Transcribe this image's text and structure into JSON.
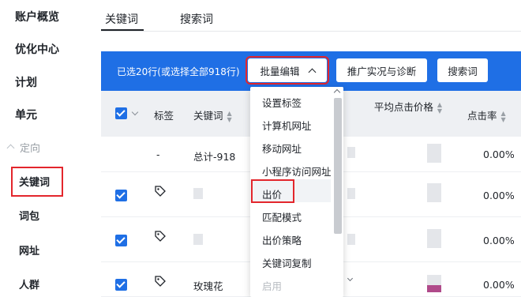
{
  "sidebar": {
    "items": [
      {
        "label": "账户概览"
      },
      {
        "label": "优化中心"
      },
      {
        "label": "计划"
      },
      {
        "label": "单元"
      }
    ],
    "group_label": "定向",
    "sub_items": [
      {
        "label": "关键词",
        "active": true
      },
      {
        "label": "词包"
      },
      {
        "label": "网址"
      },
      {
        "label": "人群"
      }
    ]
  },
  "tabs": [
    {
      "label": "关键词",
      "active": true
    },
    {
      "label": "搜索词"
    }
  ],
  "toolbar": {
    "selection_text": "已选20行(或选择全部918行)",
    "batch_edit_label": "批量编辑",
    "diagnose_label": "推广实况与诊断",
    "search_terms_label": "搜索词"
  },
  "table": {
    "headers": {
      "tag": "标签",
      "keyword": "关键词",
      "avg_cpc": "平均点击价格",
      "ctr": "点击率"
    },
    "rows": [
      {
        "tag": "-",
        "keyword": "总计-918",
        "ctr": "0.00%"
      },
      {
        "tag": "",
        "keyword": "",
        "ctr": "0.00%"
      },
      {
        "tag": "",
        "keyword": "",
        "ctr": "0.00%"
      },
      {
        "tag": "",
        "keyword": "玫瑰花",
        "ctr": "0.00%"
      }
    ]
  },
  "dropdown": {
    "items": [
      {
        "label": "设置标签"
      },
      {
        "label": "计算机网址"
      },
      {
        "label": "移动网址"
      },
      {
        "label": "小程序访问网址"
      },
      {
        "label": "出价",
        "highlighted": true
      },
      {
        "label": "匹配模式"
      },
      {
        "label": "出价策略"
      },
      {
        "label": "关键词复制"
      },
      {
        "label": "启用",
        "disabled": true
      }
    ]
  },
  "colors": {
    "accent": "#1f6fe5",
    "highlight_outline": "#e3262c"
  }
}
